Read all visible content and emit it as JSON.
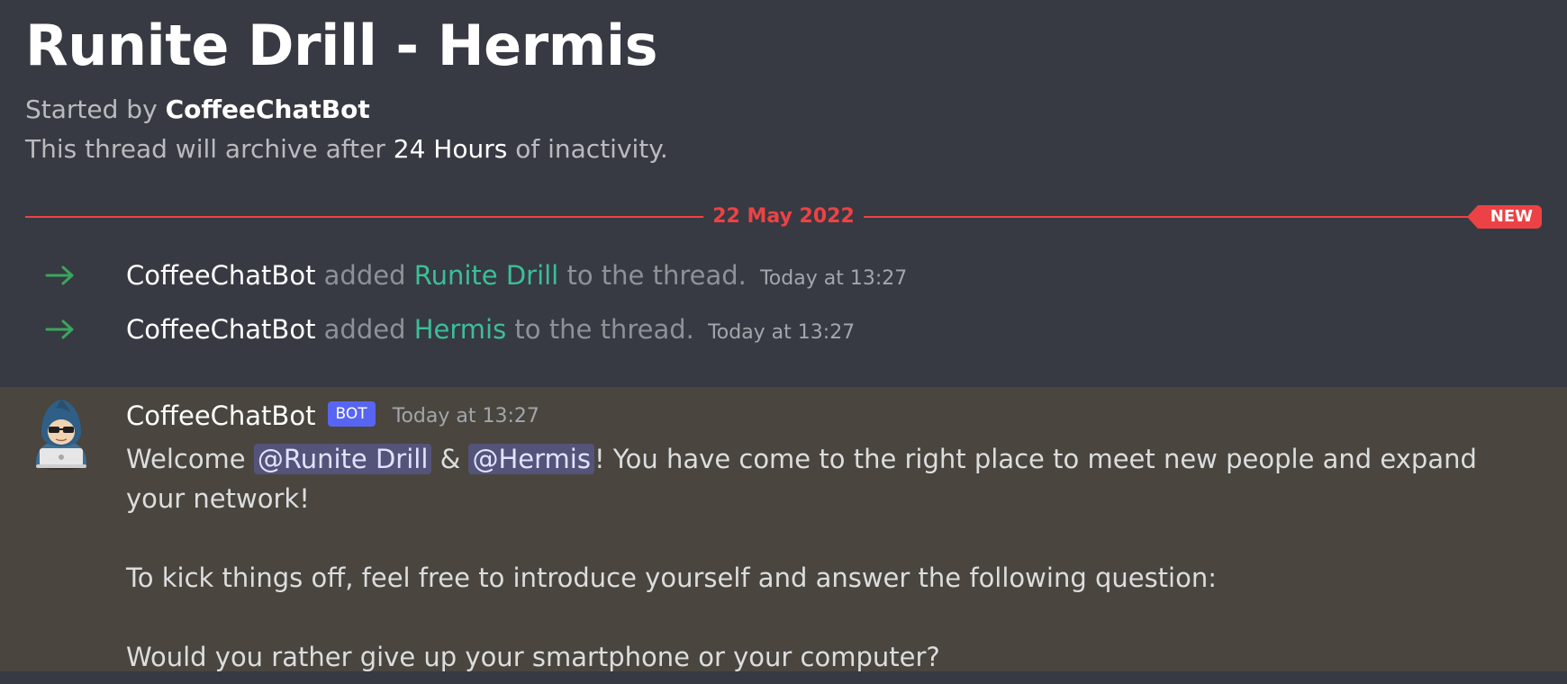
{
  "thread": {
    "title": "Runite Drill - Hermis",
    "started_by_prefix": "Started by",
    "started_by_user": "CoffeeChatBot",
    "archive_prefix": "This thread will archive after",
    "archive_duration": "24 Hours",
    "archive_suffix": "of inactivity."
  },
  "divider": {
    "date": "22 May 2022",
    "new_badge": "NEW",
    "color": "#ed4245"
  },
  "system_messages": [
    {
      "actor": "CoffeeChatBot",
      "action": "added",
      "target": "Runite Drill",
      "suffix": "to the thread.",
      "timestamp": "Today at 13:27",
      "icon": "arrow-right-icon"
    },
    {
      "actor": "CoffeeChatBot",
      "action": "added",
      "target": "Hermis",
      "suffix": "to the thread.",
      "timestamp": "Today at 13:27",
      "icon": "arrow-right-icon"
    }
  ],
  "bot_message": {
    "username": "CoffeeChatBot",
    "tag": "BOT",
    "timestamp": "Today at 13:27",
    "avatar_icon": "hooded-hacker-avatar",
    "welcome_prefix": "Welcome",
    "mention_1": "@Runite Drill",
    "ampersand": "&",
    "mention_2": "@Hermis",
    "welcome_suffix": "! You have come to the right place to meet new people and expand your network!",
    "paragraph_2": "To kick things off, feel free to introduce yourself and answer the following question:",
    "paragraph_3": "Would you rather give up your smartphone or your computer?"
  },
  "colors": {
    "background": "#373a42",
    "highlight_background": "#4a453f",
    "accent_green": "#3bbf98",
    "bot_tag": "#5865f2",
    "mention_bg": "#54537a"
  }
}
